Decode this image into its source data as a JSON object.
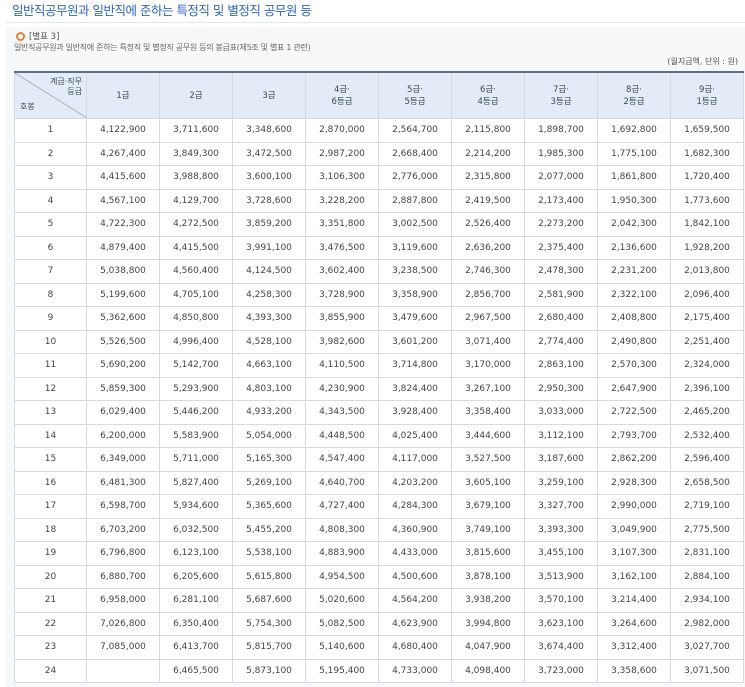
{
  "page_title": "일반직공무원과 일반직에 준하는 특정직 및 별정직 공무원 등",
  "table_tag": "[별표 3]",
  "table_caption": "일반직공무원과 일반직에 준하는 특정직 및 별정직 공무원 등의 봉급표(제5조 및 별표 1 관련)",
  "unit_note": "(월지급액, 단위 : 원)",
  "header": {
    "corner_top_line1": "계급·직무",
    "corner_top_line2": "등급",
    "corner_bottom": "호봉",
    "columns": [
      {
        "line1": "1급",
        "line2": ""
      },
      {
        "line1": "2급",
        "line2": ""
      },
      {
        "line1": "3급",
        "line2": ""
      },
      {
        "line1": "4급·",
        "line2": "6등급"
      },
      {
        "line1": "5급·",
        "line2": "5등급"
      },
      {
        "line1": "6급·",
        "line2": "4등급"
      },
      {
        "line1": "7급·",
        "line2": "3등급"
      },
      {
        "line1": "8급·",
        "line2": "2등급"
      },
      {
        "line1": "9급·",
        "line2": "1등급"
      }
    ]
  },
  "rows": [
    {
      "step": "1",
      "cells": [
        "4,122,900",
        "3,711,600",
        "3,348,600",
        "2,870,000",
        "2,564,700",
        "2,115,800",
        "1,898,700",
        "1,692,800",
        "1,659,500"
      ]
    },
    {
      "step": "2",
      "cells": [
        "4,267,400",
        "3,849,300",
        "3,472,500",
        "2,987,200",
        "2,668,400",
        "2,214,200",
        "1,985,300",
        "1,775,100",
        "1,682,300"
      ]
    },
    {
      "step": "3",
      "cells": [
        "4,415,600",
        "3,988,800",
        "3,600,100",
        "3,106,300",
        "2,776,000",
        "2,315,800",
        "2,077,000",
        "1,861,800",
        "1,720,400"
      ]
    },
    {
      "step": "4",
      "cells": [
        "4,567,100",
        "4,129,700",
        "3,728,600",
        "3,228,200",
        "2,887,800",
        "2,419,500",
        "2,173,400",
        "1,950,300",
        "1,773,600"
      ]
    },
    {
      "step": "5",
      "cells": [
        "4,722,300",
        "4,272,500",
        "3,859,200",
        "3,351,800",
        "3,002,500",
        "2,526,400",
        "2,273,200",
        "2,042,300",
        "1,842,100"
      ]
    },
    {
      "step": "6",
      "cells": [
        "4,879,400",
        "4,415,500",
        "3,991,100",
        "3,476,500",
        "3,119,600",
        "2,636,200",
        "2,375,400",
        "2,136,600",
        "1,928,200"
      ]
    },
    {
      "step": "7",
      "cells": [
        "5,038,800",
        "4,560,400",
        "4,124,500",
        "3,602,400",
        "3,238,500",
        "2,746,300",
        "2,478,300",
        "2,231,200",
        "2,013,800"
      ]
    },
    {
      "step": "8",
      "cells": [
        "5,199,600",
        "4,705,100",
        "4,258,300",
        "3,728,900",
        "3,358,900",
        "2,856,700",
        "2,581,900",
        "2,322,100",
        "2,096,400"
      ]
    },
    {
      "step": "9",
      "cells": [
        "5,362,600",
        "4,850,800",
        "4,393,300",
        "3,855,900",
        "3,479,600",
        "2,967,500",
        "2,680,400",
        "2,408,800",
        "2,175,400"
      ]
    },
    {
      "step": "10",
      "cells": [
        "5,526,500",
        "4,996,400",
        "4,528,100",
        "3,982,600",
        "3,601,200",
        "3,071,400",
        "2,774,400",
        "2,490,800",
        "2,251,400"
      ]
    },
    {
      "step": "11",
      "cells": [
        "5,690,200",
        "5,142,700",
        "4,663,100",
        "4,110,500",
        "3,714,800",
        "3,170,000",
        "2,863,100",
        "2,570,300",
        "2,324,000"
      ]
    },
    {
      "step": "12",
      "cells": [
        "5,859,300",
        "5,293,900",
        "4,803,100",
        "4,230,900",
        "3,824,400",
        "3,267,100",
        "2,950,300",
        "2,647,900",
        "2,396,100"
      ]
    },
    {
      "step": "13",
      "cells": [
        "6,029,400",
        "5,446,200",
        "4,933,200",
        "4,343,500",
        "3,928,400",
        "3,358,400",
        "3,033,000",
        "2,722,500",
        "2,465,200"
      ]
    },
    {
      "step": "14",
      "cells": [
        "6,200,000",
        "5,583,900",
        "5,054,000",
        "4,448,500",
        "4,025,400",
        "3,444,600",
        "3,112,100",
        "2,793,700",
        "2,532,400"
      ]
    },
    {
      "step": "15",
      "cells": [
        "6,349,000",
        "5,711,000",
        "5,165,300",
        "4,547,400",
        "4,117,000",
        "3,527,500",
        "3,187,600",
        "2,862,200",
        "2,596,400"
      ]
    },
    {
      "step": "16",
      "cells": [
        "6,481,300",
        "5,827,400",
        "5,269,100",
        "4,640,700",
        "4,203,200",
        "3,605,100",
        "3,259,100",
        "2,928,300",
        "2,658,500"
      ]
    },
    {
      "step": "17",
      "cells": [
        "6,598,700",
        "5,934,600",
        "5,365,600",
        "4,727,400",
        "4,284,300",
        "3,679,100",
        "3,327,700",
        "2,990,000",
        "2,719,100"
      ]
    },
    {
      "step": "18",
      "cells": [
        "6,703,200",
        "6,032,500",
        "5,455,200",
        "4,808,300",
        "4,360,900",
        "3,749,100",
        "3,393,300",
        "3,049,900",
        "2,775,500"
      ]
    },
    {
      "step": "19",
      "cells": [
        "6,796,800",
        "6,123,100",
        "5,538,100",
        "4,883,900",
        "4,433,000",
        "3,815,600",
        "3,455,100",
        "3,107,300",
        "2,831,100"
      ]
    },
    {
      "step": "20",
      "cells": [
        "6,880,700",
        "6,205,600",
        "5,615,800",
        "4,954,500",
        "4,500,600",
        "3,878,100",
        "3,513,900",
        "3,162,100",
        "2,884,100"
      ]
    },
    {
      "step": "21",
      "cells": [
        "6,958,000",
        "6,281,100",
        "5,687,600",
        "5,020,600",
        "4,564,200",
        "3,938,200",
        "3,570,100",
        "3,214,400",
        "2,934,100"
      ]
    },
    {
      "step": "22",
      "cells": [
        "7,026,800",
        "6,350,400",
        "5,754,300",
        "5,082,500",
        "4,623,900",
        "3,994,800",
        "3,623,100",
        "3,264,600",
        "2,982,000"
      ]
    },
    {
      "step": "23",
      "cells": [
        "7,085,000",
        "6,413,700",
        "5,815,700",
        "5,140,600",
        "4,680,400",
        "4,047,900",
        "3,674,400",
        "3,312,400",
        "3,027,700"
      ]
    },
    {
      "step": "24",
      "cells": [
        "",
        "6,465,500",
        "5,873,100",
        "5,195,400",
        "4,733,000",
        "4,098,400",
        "3,723,000",
        "3,358,600",
        "3,071,500"
      ]
    }
  ]
}
